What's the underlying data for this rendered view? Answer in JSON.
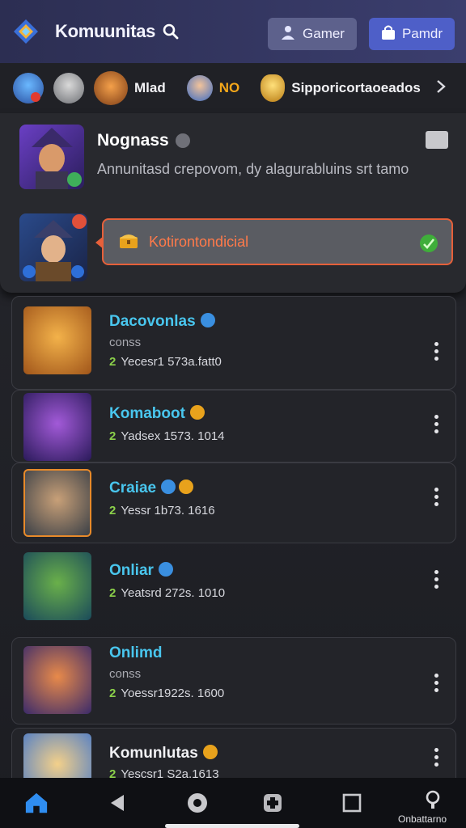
{
  "header": {
    "title": "Komuunitas",
    "gamer_label": "Gamer",
    "pamer_label": "Pamdr",
    "accent": "#4e5fc8"
  },
  "strip": {
    "items": [
      {
        "icon": "warrior-icon",
        "label": ""
      },
      {
        "icon": "robot-icon",
        "label": ""
      },
      {
        "icon": "beast-icon",
        "label": "Mlad"
      },
      {
        "icon": "hero-icon",
        "label": "NO"
      },
      {
        "icon": "shield-gold-icon",
        "label": "Sipporicortaoeados"
      }
    ]
  },
  "featured": {
    "name": "Nognass",
    "description": "Annunitasd crepovom, dy alagurabluins srt tamo",
    "notice_label": "Kotirontondicial"
  },
  "cards": [
    {
      "title": "Dacovonlas",
      "subtitle": "conss",
      "count": "2",
      "meta": "Yecesr1 573a.fatt0",
      "badge_color": "#3a8fe0"
    },
    {
      "title": "Komaboot",
      "subtitle": "",
      "count": "2",
      "meta": "Yadsex 1573. 1014",
      "badge_color": "#e8a21c"
    },
    {
      "title": "Craiae",
      "subtitle": "",
      "count": "2",
      "meta": "Yessr 1b73. 1616",
      "badge_color": "#3a8fe0"
    },
    {
      "title": "Onliar",
      "subtitle": "",
      "count": "2",
      "meta": "Yeatsrd 272s. 1010",
      "badge_color": "#3a8fe0"
    },
    {
      "title": "Onlimd",
      "subtitle": "conss",
      "count": "2",
      "meta": "Yoessr1922s. 1600",
      "badge_color": ""
    },
    {
      "title": "Komunlutas",
      "subtitle": "",
      "count": "2",
      "meta": "Yescsr1 S2a.1613",
      "badge_color": "#e8a21c"
    }
  ],
  "nav": {
    "label": "Onbattarno"
  }
}
